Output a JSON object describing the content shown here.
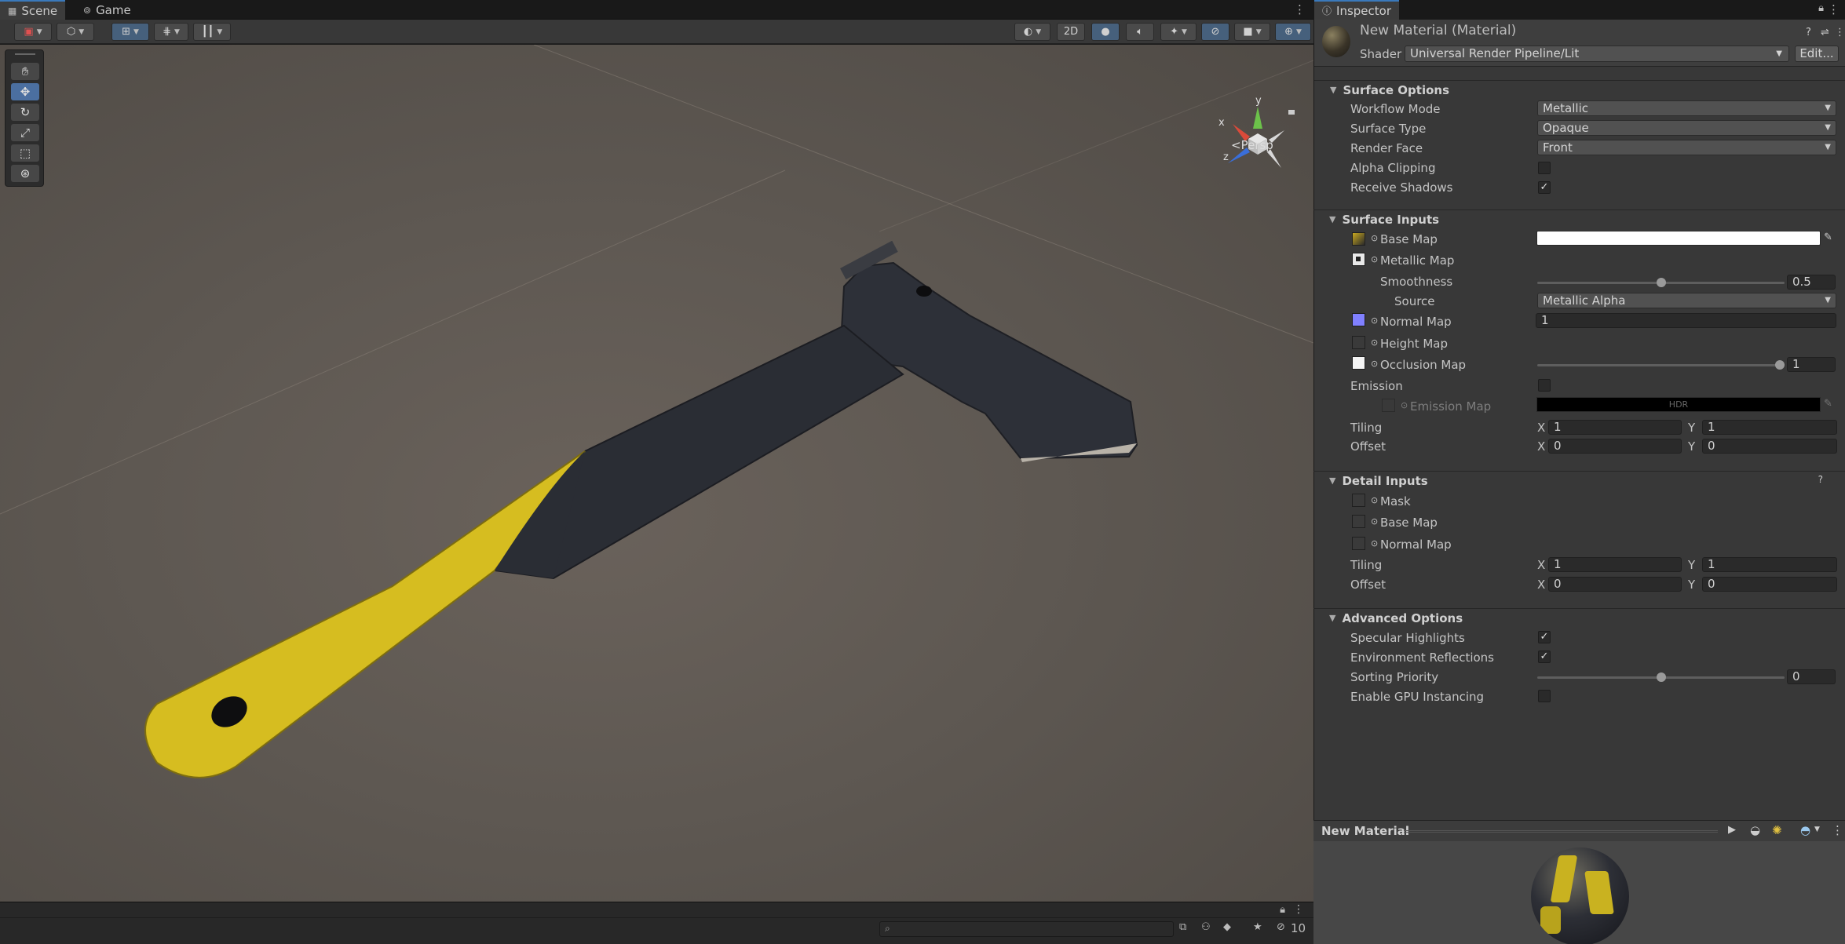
{
  "scene": {
    "tabs": [
      {
        "label": "Scene",
        "icon": "grid-icon"
      },
      {
        "label": "Game",
        "icon": "gamepad-icon"
      }
    ],
    "toolbar": {
      "toggle_2d_label": "2D"
    },
    "tools": [
      "hand-tool",
      "move-tool",
      "rotate-tool",
      "scale-tool",
      "rect-tool",
      "transform-tool"
    ],
    "gizmo": {
      "x": "x",
      "y": "y",
      "z": "z"
    },
    "persp_label": "Persp",
    "status": {
      "hidden_count": "10"
    }
  },
  "inspector": {
    "tab_label": "Inspector",
    "title": "New Material (Material)",
    "shader_label": "Shader",
    "shader_value": "Universal Render Pipeline/Lit",
    "edit_label": "Edit...",
    "surface_options": {
      "title": "Surface Options",
      "workflow_mode": {
        "label": "Workflow Mode",
        "value": "Metallic"
      },
      "surface_type": {
        "label": "Surface Type",
        "value": "Opaque"
      },
      "render_face": {
        "label": "Render Face",
        "value": "Front"
      },
      "alpha_clipping": {
        "label": "Alpha Clipping",
        "checked": false
      },
      "receive_shadows": {
        "label": "Receive Shadows",
        "checked": true
      }
    },
    "surface_inputs": {
      "title": "Surface Inputs",
      "base_map": "Base Map",
      "metallic_map": "Metallic Map",
      "smoothness": {
        "label": "Smoothness",
        "value": "0.5",
        "fraction": 0.5
      },
      "source": {
        "label": "Source",
        "value": "Metallic Alpha"
      },
      "normal_map": {
        "label": "Normal Map",
        "value": "1"
      },
      "height_map": "Height Map",
      "occlusion_map": {
        "label": "Occlusion Map",
        "value": "1",
        "fraction": 1.0
      },
      "emission": {
        "label": "Emission",
        "checked": false
      },
      "emission_map": {
        "label": "Emission Map",
        "hdr": "HDR"
      },
      "tiling": {
        "label": "Tiling",
        "x": "1",
        "y": "1"
      },
      "offset": {
        "label": "Offset",
        "x": "0",
        "y": "0"
      }
    },
    "detail_inputs": {
      "title": "Detail Inputs",
      "mask": "Mask",
      "base_map": "Base Map",
      "normal_map": "Normal Map",
      "tiling": {
        "label": "Tiling",
        "x": "1",
        "y": "1"
      },
      "offset": {
        "label": "Offset",
        "x": "0",
        "y": "0"
      }
    },
    "advanced_options": {
      "title": "Advanced Options",
      "specular_highlights": {
        "label": "Specular Highlights",
        "checked": true
      },
      "environment_reflections": {
        "label": "Environment Reflections",
        "checked": true
      },
      "sorting_priority": {
        "label": "Sorting Priority",
        "value": "0",
        "fraction": 0.5
      },
      "gpu_instancing": {
        "label": "Enable GPU Instancing",
        "checked": false
      }
    },
    "preview": {
      "title": "New Material"
    },
    "axis_x": "X",
    "axis_y": "Y"
  },
  "colors": {
    "accent": "#3a79bb",
    "axe_yellow": "#d9c11e",
    "axe_dark": "#2d3038",
    "normal_map_swatch": "#8080ff"
  }
}
